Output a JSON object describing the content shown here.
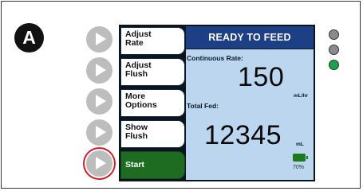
{
  "badge": "A",
  "soft_keys": [
    {
      "line1": "Adjust",
      "line2": "Rate"
    },
    {
      "line1": "Adjust",
      "line2": "Flush"
    },
    {
      "line1": "More",
      "line2": "Options"
    },
    {
      "line1": "Show",
      "line2": "Flush"
    },
    {
      "line1": "Start",
      "line2": ""
    }
  ],
  "status_title": "READY TO FEED",
  "continuous_rate": {
    "label": "Continuous Rate:",
    "value": "150",
    "unit": "mL/hr"
  },
  "total_fed": {
    "label": "Total Fed:",
    "value": "12345",
    "unit": "mL"
  },
  "battery": {
    "percent_label": "70%",
    "level": 0.7
  },
  "indicator_leds": [
    {
      "name": "led-top",
      "color": "#8a8a8a"
    },
    {
      "name": "led-middle",
      "color": "#8a8a8a"
    },
    {
      "name": "led-bottom",
      "color": "#16a34a"
    }
  ],
  "colors": {
    "header": "#1d3f86",
    "panel": "#bcd6ef",
    "start_key": "#1e6b22",
    "focus_ring": "#c8202c"
  }
}
